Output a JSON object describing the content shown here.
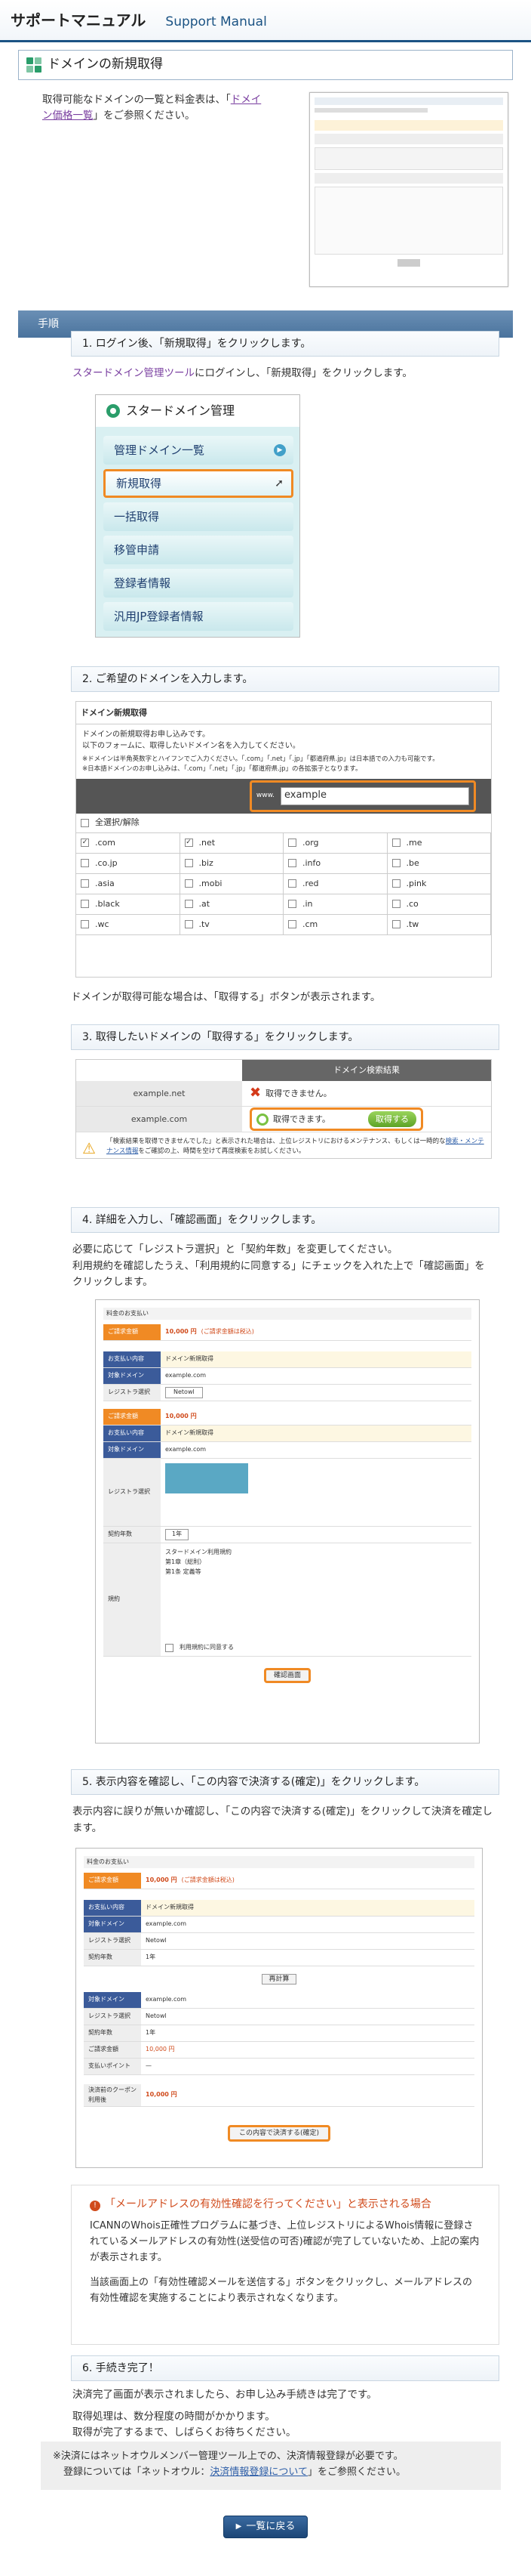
{
  "header": {
    "title_ja": "サポートマニュアル",
    "title_en": "Support Manual"
  },
  "page_title": "ドメインの新規取得",
  "intro": {
    "text_before": "取得可能なドメインの一覧と料金表は、「",
    "link": "ドメイン価格一覧",
    "text_after": "」をご参照ください。"
  },
  "section_title": "手順",
  "steps": [
    {
      "heading": "1. ログイン後、「新規取得」をクリックします。",
      "text_link": "スタードメイン管理ツール",
      "text_rest": "にログインし、「新規取得」をクリックします。"
    },
    {
      "heading": "2. ご希望のドメインを入力します。",
      "after_text": "ドメインが取得可能な場合は、「取得する」ボタンが表示されます。"
    },
    {
      "heading": "3. 取得したいドメインの「取得する」をクリックします。"
    },
    {
      "heading": "4. 詳細を入力し、「確認画面」をクリックします。",
      "text": [
        "必要に応じて「レジストラ選択」と「契約年数」を変更してください。",
        "利用規約を確認したうえ、「利用規約に同意する」にチェックを入れた上で「確認画面」をクリックします。"
      ]
    },
    {
      "heading": "5. 表示内容を確認し、「この内容で決済する(確定)」をクリックします。",
      "text": [
        "表示内容に誤りが無いか確認し、「この内容で決済する(確定)」をクリックして決済を確定します。"
      ]
    },
    {
      "heading": "6. 手続き完了！",
      "text": [
        "決済完了画面が表示されましたら、お申し込み手続きは完了です。",
        "取得処理は、数分程度の時間がかかります。",
        "取得が完了するまで、しばらくお待ちください。"
      ]
    }
  ],
  "sidebar_mock": {
    "title": "スタードメイン管理",
    "items": [
      "管理ドメイン一覧",
      "新規取得",
      "一括取得",
      "移管申請",
      "登録者情報",
      "汎用JP登録者情報"
    ]
  },
  "domain_mock": {
    "title": "ドメイン新規取得",
    "lines": [
      "ドメインの新規取得お申し込みです。",
      "以下のフォームに、取得したいドメイン名を入力してください。"
    ],
    "notes": [
      "※ドメインは半角英数字とハイフンでご入力ください。「.com」「.net」「.jp」「都道府県.jp」は日本語での入力も可能です。",
      "※日本語ドメインのお申し込みは、「.com」「.net」「.jp」「都道府県.jp」の各拡張子となります。"
    ],
    "input_label": "www.",
    "input_value": "example",
    "select_all": "全選択/解除",
    "tlds": [
      ".com",
      ".net",
      ".org",
      ".me",
      ".co.jp",
      ".biz",
      ".info",
      ".be",
      ".asia",
      ".mobi",
      ".red",
      ".pink",
      ".black",
      ".at",
      ".in",
      ".co",
      ".wc",
      ".tv",
      ".cm",
      ".tw"
    ],
    "checked": [
      ".com",
      ".net"
    ]
  },
  "result_mock": {
    "header": "ドメイン検索結果",
    "rows": [
      {
        "domain": "example.net",
        "status": "取得できません。"
      },
      {
        "domain": "example.com",
        "status": "取得できます。",
        "button": "取得する"
      }
    ],
    "note": "「検索結果を取得できませんでした」と表示された場合は、上位レジストリにおけるメンテナンス、もしくは一時的な",
    "note_link": "検索・メンテナンス情報",
    "note_rest": "をご確認の上、時間を空けて再度検索をお試しください。"
  },
  "form_mock": {
    "heading": "料金のお支払い",
    "price_label": "ご請求金額",
    "price": "10,000 円",
    "price_note": "(ご請求金額は税込)",
    "plan_label": "お支払い内容",
    "plan_value": "ドメイン新規取得",
    "domain_label": "対象ドメイン",
    "domain_value": "example.com",
    "registrar_label": "レジストラ選択",
    "registrar_value": "Netowl",
    "years_label": "契約年数",
    "years_value": "1年",
    "terms_label": "規約",
    "terms_title": "スタードメイン利用規約",
    "terms_lines": [
      "第1章（総則）",
      "第1条 定義等"
    ],
    "agree": "利用規約に同意する",
    "confirm_button": "確認画面"
  },
  "confirm_mock": {
    "total_label": "決済前のクーポン利用後",
    "payment_label": "支払いポイント",
    "recalc": "再計算",
    "submit": "この内容で決済する(確定)",
    "balance": "10,000 円"
  },
  "notice": {
    "title": "「メールアドレスの有効性確認を行ってください」と表示される場合",
    "para1": "ICANNのWhois正確性プログラムに基づき、上位レジストリによるWhois情報に登録されているメールアドレスの有効性(送受信の可否)確認が完了していないため、上記の案内が表示されます。",
    "para2": "当該画面上の「有効性確認メールを送信する」ボタンをクリックし、メールアドレスの有効性確認を実施することにより表示されなくなります。"
  },
  "footer_note": {
    "line1": "※決済にはネットオウルメンバー管理ツール上での、決済情報登録が必要です。",
    "line2_before": "登録については「ネットオウル：",
    "line2_link": "決済情報登録について",
    "line2_after": "」をご参照ください。"
  },
  "back_button": "一覧に戻る",
  "colors": {
    "accent": "#f08a24",
    "nav": "#1b5384",
    "link": "#2f5fa8"
  }
}
